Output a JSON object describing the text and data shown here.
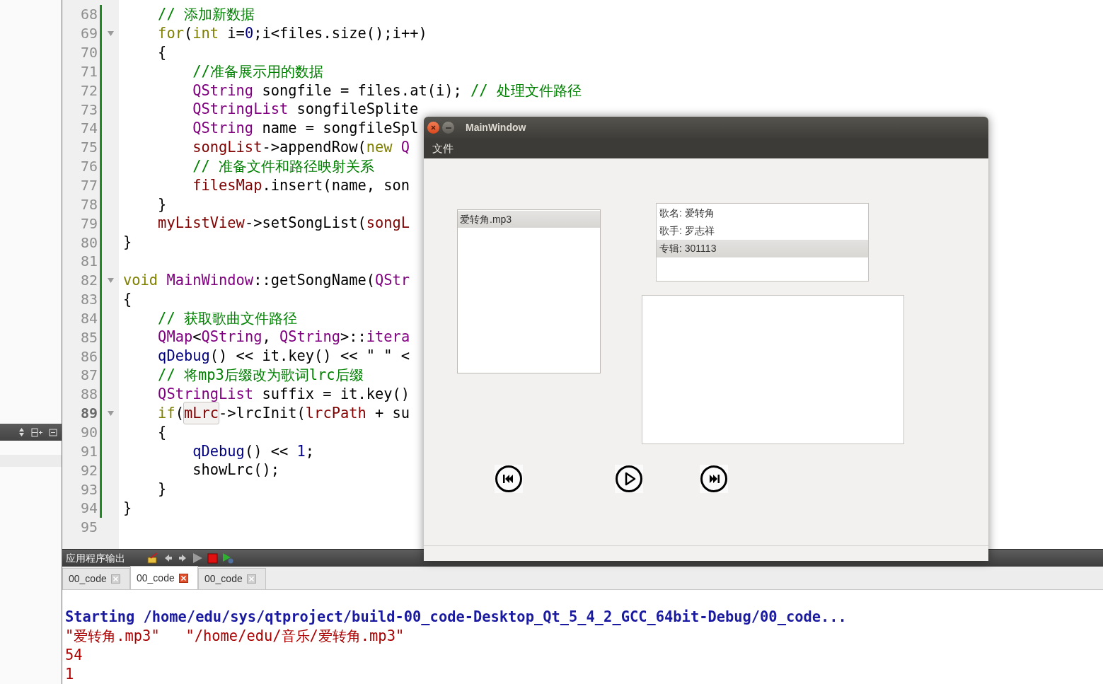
{
  "editor": {
    "lines": [
      {
        "number": "68",
        "changed": true,
        "tokens": [
          {
            "kind": "comment",
            "text": "    // 添加新数据"
          }
        ]
      },
      {
        "number": "69",
        "changed": true,
        "foldable": true,
        "tokens": [
          {
            "kind": "keyword",
            "text": "    for"
          },
          {
            "kind": "plain",
            "text": "("
          },
          {
            "kind": "keyword",
            "text": "int"
          },
          {
            "kind": "plain",
            "text": " i="
          },
          {
            "kind": "number",
            "text": "0"
          },
          {
            "kind": "plain",
            "text": ";i<files.size();i++)"
          }
        ]
      },
      {
        "number": "70",
        "changed": true,
        "tokens": [
          {
            "kind": "plain",
            "text": "    {"
          }
        ]
      },
      {
        "number": "71",
        "changed": true,
        "tokens": [
          {
            "kind": "comment",
            "text": "        //准备展示用的数据"
          }
        ]
      },
      {
        "number": "72",
        "changed": true,
        "tokens": [
          {
            "kind": "type",
            "text": "        QString"
          },
          {
            "kind": "plain",
            "text": " songfile = files.at(i); "
          },
          {
            "kind": "comment",
            "text": "// 处理文件路径"
          }
        ]
      },
      {
        "number": "73",
        "changed": true,
        "tokens": [
          {
            "kind": "type",
            "text": "        QStringList"
          },
          {
            "kind": "plain",
            "text": " songfileSplite"
          }
        ]
      },
      {
        "number": "74",
        "changed": true,
        "tokens": [
          {
            "kind": "type",
            "text": "        QString"
          },
          {
            "kind": "plain",
            "text": " name = songfileSpl"
          }
        ]
      },
      {
        "number": "75",
        "changed": true,
        "tokens": [
          {
            "kind": "member",
            "text": "        songList"
          },
          {
            "kind": "plain",
            "text": "->appendRow("
          },
          {
            "kind": "keyword",
            "text": "new"
          },
          {
            "kind": "type",
            "text": " Q"
          }
        ]
      },
      {
        "number": "76",
        "changed": true,
        "tokens": [
          {
            "kind": "comment",
            "text": "        // 准备文件和路径映射关系"
          }
        ]
      },
      {
        "number": "77",
        "changed": true,
        "tokens": [
          {
            "kind": "member",
            "text": "        filesMap"
          },
          {
            "kind": "plain",
            "text": ".insert(name, son"
          }
        ]
      },
      {
        "number": "78",
        "changed": true,
        "tokens": [
          {
            "kind": "plain",
            "text": "    }"
          }
        ]
      },
      {
        "number": "79",
        "changed": true,
        "tokens": [
          {
            "kind": "member",
            "text": "    myListView"
          },
          {
            "kind": "plain",
            "text": "->setSongList("
          },
          {
            "kind": "member",
            "text": "songL"
          }
        ]
      },
      {
        "number": "80",
        "changed": true,
        "tokens": [
          {
            "kind": "plain",
            "text": "}"
          }
        ]
      },
      {
        "number": "81",
        "changed": true
      },
      {
        "number": "82",
        "changed": true,
        "foldable": true,
        "tokens": [
          {
            "kind": "keyword",
            "text": "void"
          },
          {
            "kind": "type",
            "text": " MainWindow"
          },
          {
            "kind": "plain",
            "text": "::getSongName("
          },
          {
            "kind": "type",
            "text": "QStr"
          }
        ]
      },
      {
        "number": "83",
        "changed": true,
        "tokens": [
          {
            "kind": "plain",
            "text": "{"
          }
        ]
      },
      {
        "number": "84",
        "changed": true,
        "tokens": [
          {
            "kind": "comment",
            "text": "    // 获取歌曲文件路径"
          }
        ]
      },
      {
        "number": "85",
        "changed": true,
        "tokens": [
          {
            "kind": "type",
            "text": "    QMap"
          },
          {
            "kind": "plain",
            "text": "<"
          },
          {
            "kind": "type",
            "text": "QString"
          },
          {
            "kind": "plain",
            "text": ", "
          },
          {
            "kind": "type",
            "text": "QString"
          },
          {
            "kind": "plain",
            "text": ">::"
          },
          {
            "kind": "type",
            "text": "itera"
          }
        ]
      },
      {
        "number": "86",
        "changed": true,
        "tokens": [
          {
            "kind": "func",
            "text": "    qDebug"
          },
          {
            "kind": "plain",
            "text": "() << it.key() << \" \" <"
          }
        ]
      },
      {
        "number": "87",
        "changed": true,
        "tokens": [
          {
            "kind": "comment",
            "text": "    // 将mp3后缀改为歌词lrc后缀"
          }
        ]
      },
      {
        "number": "88",
        "changed": true,
        "tokens": [
          {
            "kind": "type",
            "text": "    QStringList"
          },
          {
            "kind": "plain",
            "text": " suffix = it.key()"
          }
        ]
      },
      {
        "number": "89",
        "changed": true,
        "foldable": true,
        "current": true,
        "tokens": [
          {
            "kind": "keyword",
            "text": "    if"
          },
          {
            "kind": "plain",
            "text": "("
          },
          {
            "kind": "highlight",
            "text": "mLrc"
          },
          {
            "kind": "plain",
            "text": "->lrcInit("
          },
          {
            "kind": "member",
            "text": "lrcPath"
          },
          {
            "kind": "plain",
            "text": " + su"
          }
        ]
      },
      {
        "number": "90",
        "changed": true,
        "tokens": [
          {
            "kind": "plain",
            "text": "    {"
          }
        ]
      },
      {
        "number": "91",
        "changed": true,
        "tokens": [
          {
            "kind": "func",
            "text": "        qDebug"
          },
          {
            "kind": "plain",
            "text": "() << "
          },
          {
            "kind": "number",
            "text": "1"
          },
          {
            "kind": "plain",
            "text": ";"
          }
        ]
      },
      {
        "number": "92",
        "changed": true,
        "tokens": [
          {
            "kind": "plain",
            "text": "        showLrc();"
          }
        ]
      },
      {
        "number": "93",
        "changed": true,
        "tokens": [
          {
            "kind": "plain",
            "text": "    }"
          }
        ]
      },
      {
        "number": "94",
        "changed": true,
        "tokens": [
          {
            "kind": "plain",
            "text": "}"
          }
        ]
      },
      {
        "number": "95",
        "changed": false
      }
    ]
  },
  "app_window": {
    "title": "MainWindow",
    "menu": [
      "文件"
    ],
    "song_list": [
      {
        "text": "爱转角.mp3",
        "selected": true
      }
    ],
    "info_list": [
      {
        "text": "歌名: 爱转角",
        "selected": false
      },
      {
        "text": "歌手: 罗志祥",
        "selected": false
      },
      {
        "text": "专辑: 301113",
        "selected": true
      }
    ],
    "controls": [
      {
        "kind": "previous"
      },
      {
        "kind": "play"
      },
      {
        "kind": "next"
      }
    ]
  },
  "output_pane": {
    "title": "应用程序输出",
    "tabs": [
      {
        "label": "00_code",
        "selected": false
      },
      {
        "label": "00_code",
        "selected": true
      },
      {
        "label": "00_code",
        "selected": false
      }
    ],
    "lines": [
      {
        "kind": "info",
        "text": "Starting /home/edu/sys/qtproject/build-00_code-Desktop_Qt_5_4_2_GCC_64bit-Debug/00_code..."
      },
      {
        "kind": "output",
        "text": "\"爱转角.mp3\"   \"/home/edu/音乐/爱转角.mp3\""
      },
      {
        "kind": "output",
        "text": "54"
      },
      {
        "kind": "output",
        "text": "1"
      }
    ]
  }
}
